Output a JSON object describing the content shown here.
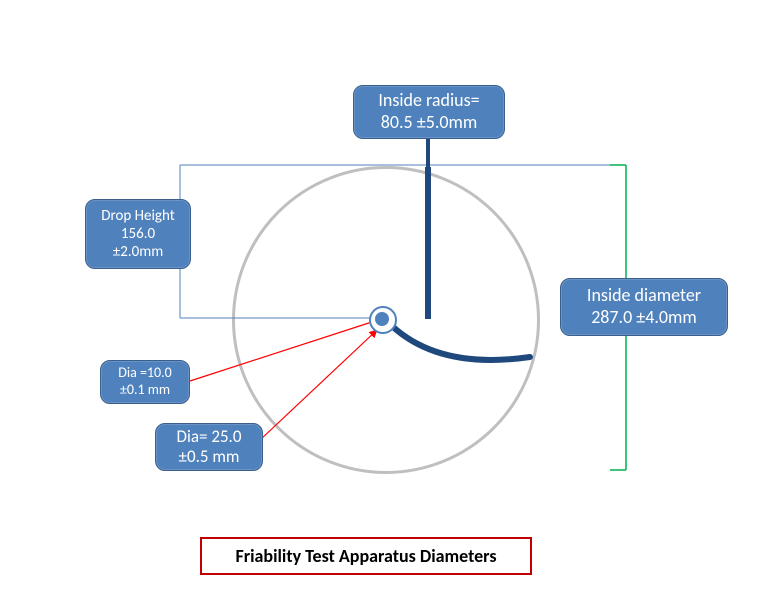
{
  "labels": {
    "inside_radius": {
      "line1": "Inside radius=",
      "line2": "80.5 ±5.0mm"
    },
    "drop_height": {
      "line1": "Drop Height",
      "line2": "156.0",
      "line3": "±2.0mm"
    },
    "inside_diameter": {
      "line1": "Inside diameter",
      "line2": "287.0 ±4.0mm"
    },
    "dia_small": {
      "line1": "Dia =10.0",
      "line2": "±0.1 mm"
    },
    "dia_large": {
      "line1": "Dia= 25.0",
      "line2": "±0.5 mm"
    }
  },
  "caption": "Friability Test Apparatus Diameters",
  "chart_data": {
    "type": "diagram",
    "title": "Friability Test Apparatus Diameters",
    "measurements": [
      {
        "name": "Inside radius",
        "value": 80.5,
        "tolerance": 5.0,
        "unit": "mm"
      },
      {
        "name": "Drop Height",
        "value": 156.0,
        "tolerance": 2.0,
        "unit": "mm"
      },
      {
        "name": "Inside diameter",
        "value": 287.0,
        "tolerance": 4.0,
        "unit": "mm"
      },
      {
        "name": "Dia (hub outer)",
        "value": 25.0,
        "tolerance": 0.5,
        "unit": "mm"
      },
      {
        "name": "Dia (hub inner)",
        "value": 10.0,
        "tolerance": 0.1,
        "unit": "mm"
      }
    ]
  }
}
